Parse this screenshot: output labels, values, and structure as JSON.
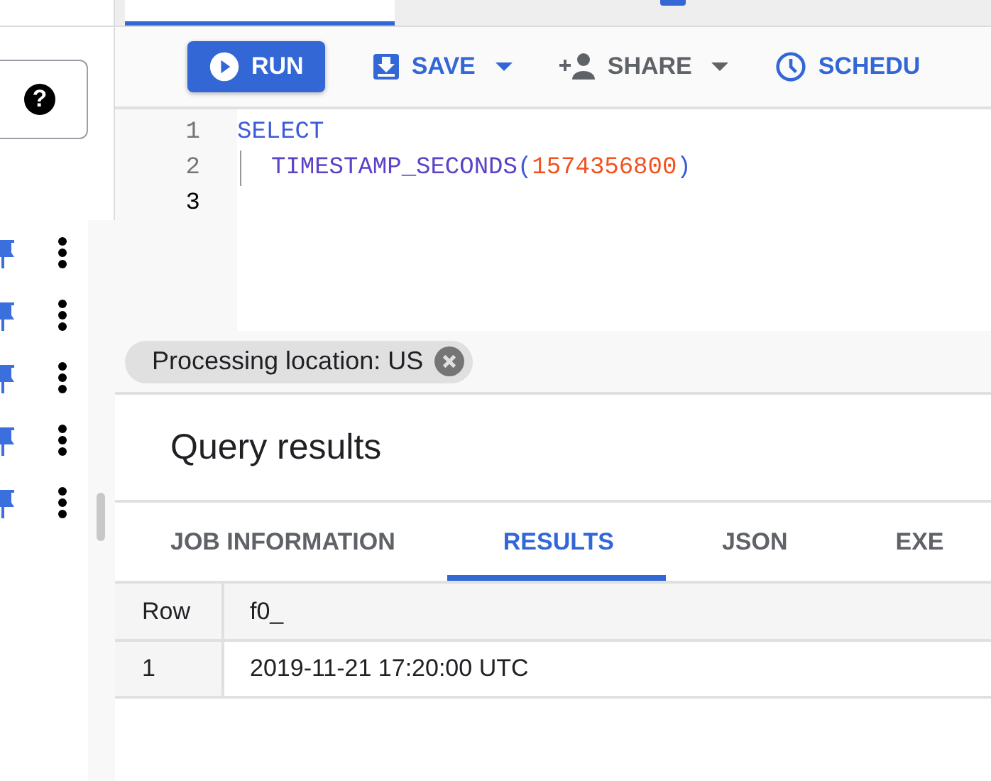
{
  "editor_tabs": [
    {
      "selected": true
    },
    {
      "selected": false
    }
  ],
  "sidebar": {
    "help_button": {
      "label": "?"
    },
    "rows": [
      {
        "pinned": true
      },
      {
        "pinned": true
      },
      {
        "pinned": true
      },
      {
        "pinned": true
      },
      {
        "pinned": true
      }
    ]
  },
  "toolbar": [
    {
      "kind": "run",
      "label": "RUN",
      "menu": false,
      "disabled": false
    },
    {
      "kind": "save",
      "label": "SAVE",
      "menu": true,
      "disabled": false
    },
    {
      "kind": "share",
      "label": "SHARE",
      "menu": true,
      "disabled": true
    },
    {
      "kind": "schedule",
      "label": "SCHEDU",
      "menu": false,
      "disabled": false
    }
  ],
  "editor": {
    "lines": [
      {
        "number": "1",
        "current": false,
        "indent": false,
        "tokens": [
          {
            "kind": "keyword",
            "text": "SELECT"
          }
        ]
      },
      {
        "number": "2",
        "current": false,
        "indent": true,
        "tokens": [
          {
            "kind": "function",
            "text": "TIMESTAMP_SECONDS"
          },
          {
            "kind": "punct",
            "text": "("
          },
          {
            "kind": "number",
            "text": "1574356800"
          },
          {
            "kind": "punct",
            "text": ")"
          }
        ]
      },
      {
        "number": "3",
        "current": true,
        "indent": false
      }
    ]
  },
  "location_chip": {
    "label": "Processing location: US"
  },
  "results": {
    "title": "Query results",
    "tabs": [
      {
        "label": "JOB INFORMATION",
        "selected": false
      },
      {
        "label": "RESULTS",
        "selected": true
      },
      {
        "label": "JSON",
        "selected": false
      },
      {
        "label": "EXE",
        "selected": false
      }
    ],
    "table": {
      "columns": [
        "Row",
        "f0_"
      ],
      "rows": [
        [
          "1",
          "2019-11-21 17:20:00 UTC"
        ]
      ]
    }
  }
}
